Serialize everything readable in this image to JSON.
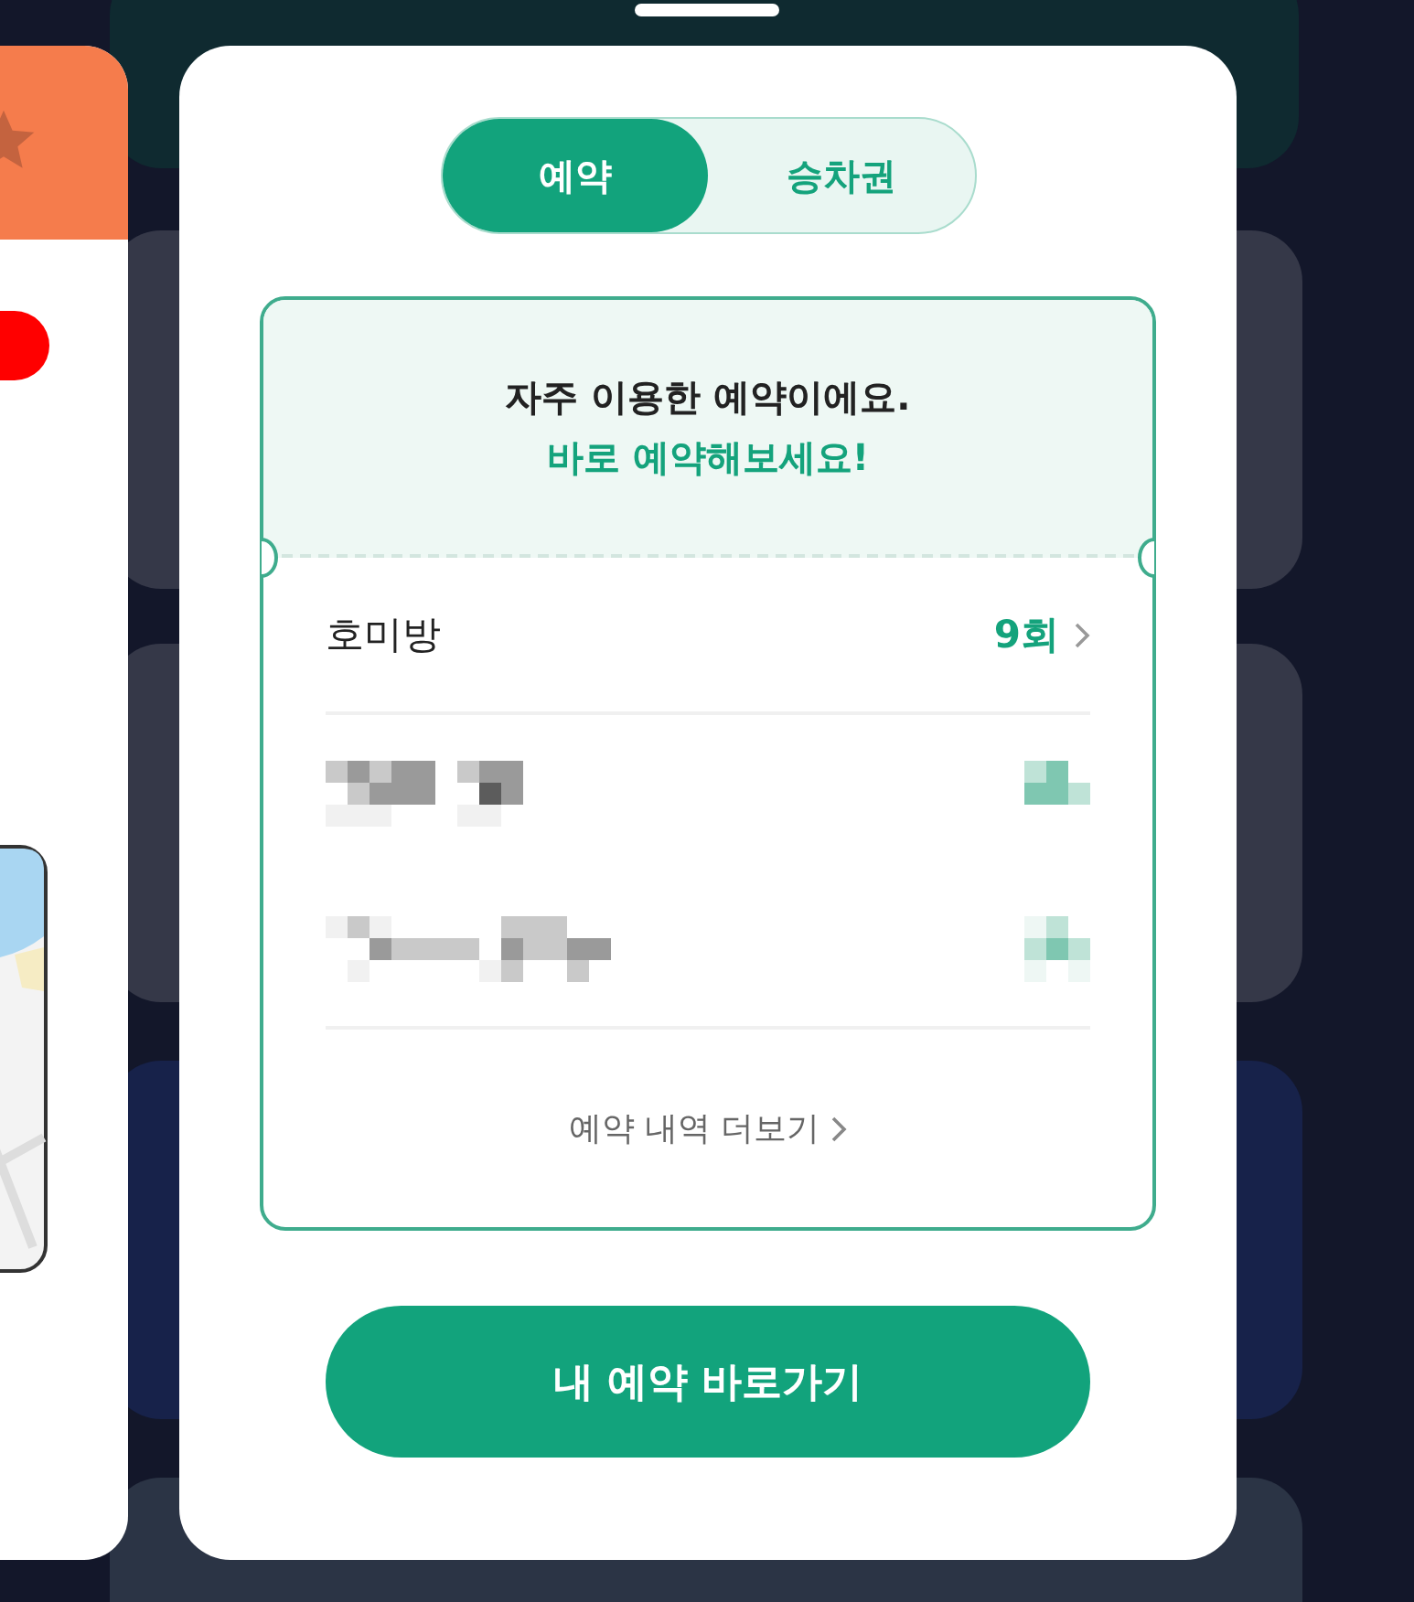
{
  "tabs": [
    {
      "label": "예약",
      "selected": true
    },
    {
      "label": "승차권",
      "selected": false
    }
  ],
  "ticket": {
    "heading": "자주 이용한 예약이에요.",
    "subheading": "바로 예약해보세요!",
    "rows": [
      {
        "kind": "text",
        "name": "호미방",
        "count": "9회"
      },
      {
        "kind": "redacted"
      },
      {
        "kind": "redacted"
      }
    ],
    "more_link": "예약 내역 더보기"
  },
  "primary_button": "내 예약 바로가기"
}
